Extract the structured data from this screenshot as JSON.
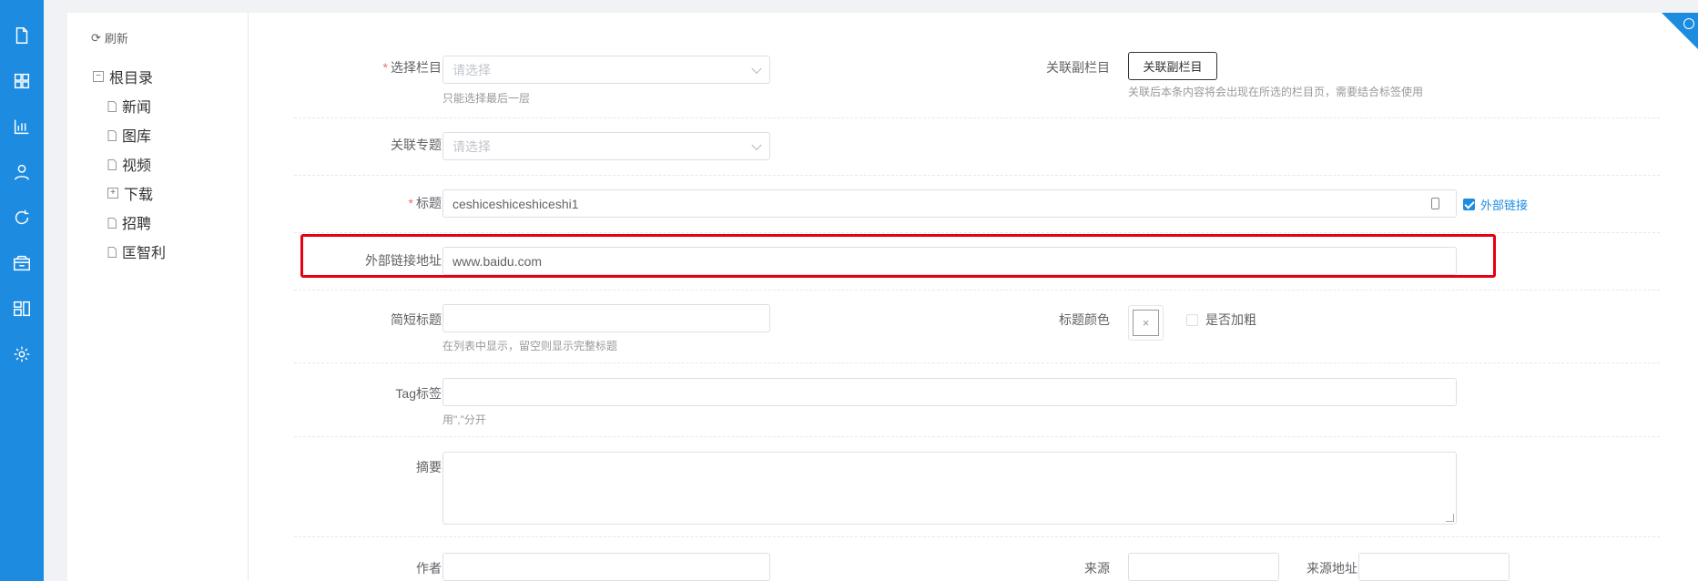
{
  "nav": {
    "icons": [
      "file-icon",
      "grid-icon",
      "chart-icon",
      "user-icon",
      "refresh-icon",
      "box-icon",
      "layout-icon",
      "gear-icon"
    ]
  },
  "tree": {
    "refresh_label": "刷新",
    "root_label": "根目录",
    "items": [
      {
        "label": "新闻",
        "type": "leaf"
      },
      {
        "label": "图库",
        "type": "leaf"
      },
      {
        "label": "视频",
        "type": "leaf"
      },
      {
        "label": "下载",
        "type": "folder"
      },
      {
        "label": "招聘",
        "type": "leaf"
      },
      {
        "label": "匡智利",
        "type": "leaf"
      }
    ]
  },
  "form": {
    "column": {
      "label": "选择栏目",
      "placeholder": "请选择",
      "help": "只能选择最后一层"
    },
    "sub_column": {
      "label": "关联副栏目",
      "button": "关联副栏目",
      "help": "关联后本条内容将会出现在所选的栏目页，需要结合标签使用"
    },
    "topic": {
      "label": "关联专题",
      "placeholder": "请选择"
    },
    "title": {
      "label": "标题",
      "value": "ceshiceshiceshiceshi1",
      "external_link_label": "外部链接",
      "external_link_checked": true
    },
    "external_url": {
      "label": "外部链接地址",
      "value": "www.baidu.com"
    },
    "short_title": {
      "label": "简短标题",
      "help": "在列表中显示，留空则显示完整标题"
    },
    "title_color": {
      "label": "标题颜色",
      "swatch_symbol": "×"
    },
    "bold": {
      "label": "是否加粗",
      "checked": false
    },
    "tags": {
      "label": "Tag标签",
      "help": "用\",\"分开"
    },
    "summary": {
      "label": "摘要"
    },
    "author": {
      "label": "作者"
    },
    "source": {
      "label": "来源"
    },
    "source_url": {
      "label": "来源地址"
    }
  },
  "colors": {
    "accent": "#1d8ce0",
    "highlight": "#e60012",
    "required": "#f56c6c"
  }
}
